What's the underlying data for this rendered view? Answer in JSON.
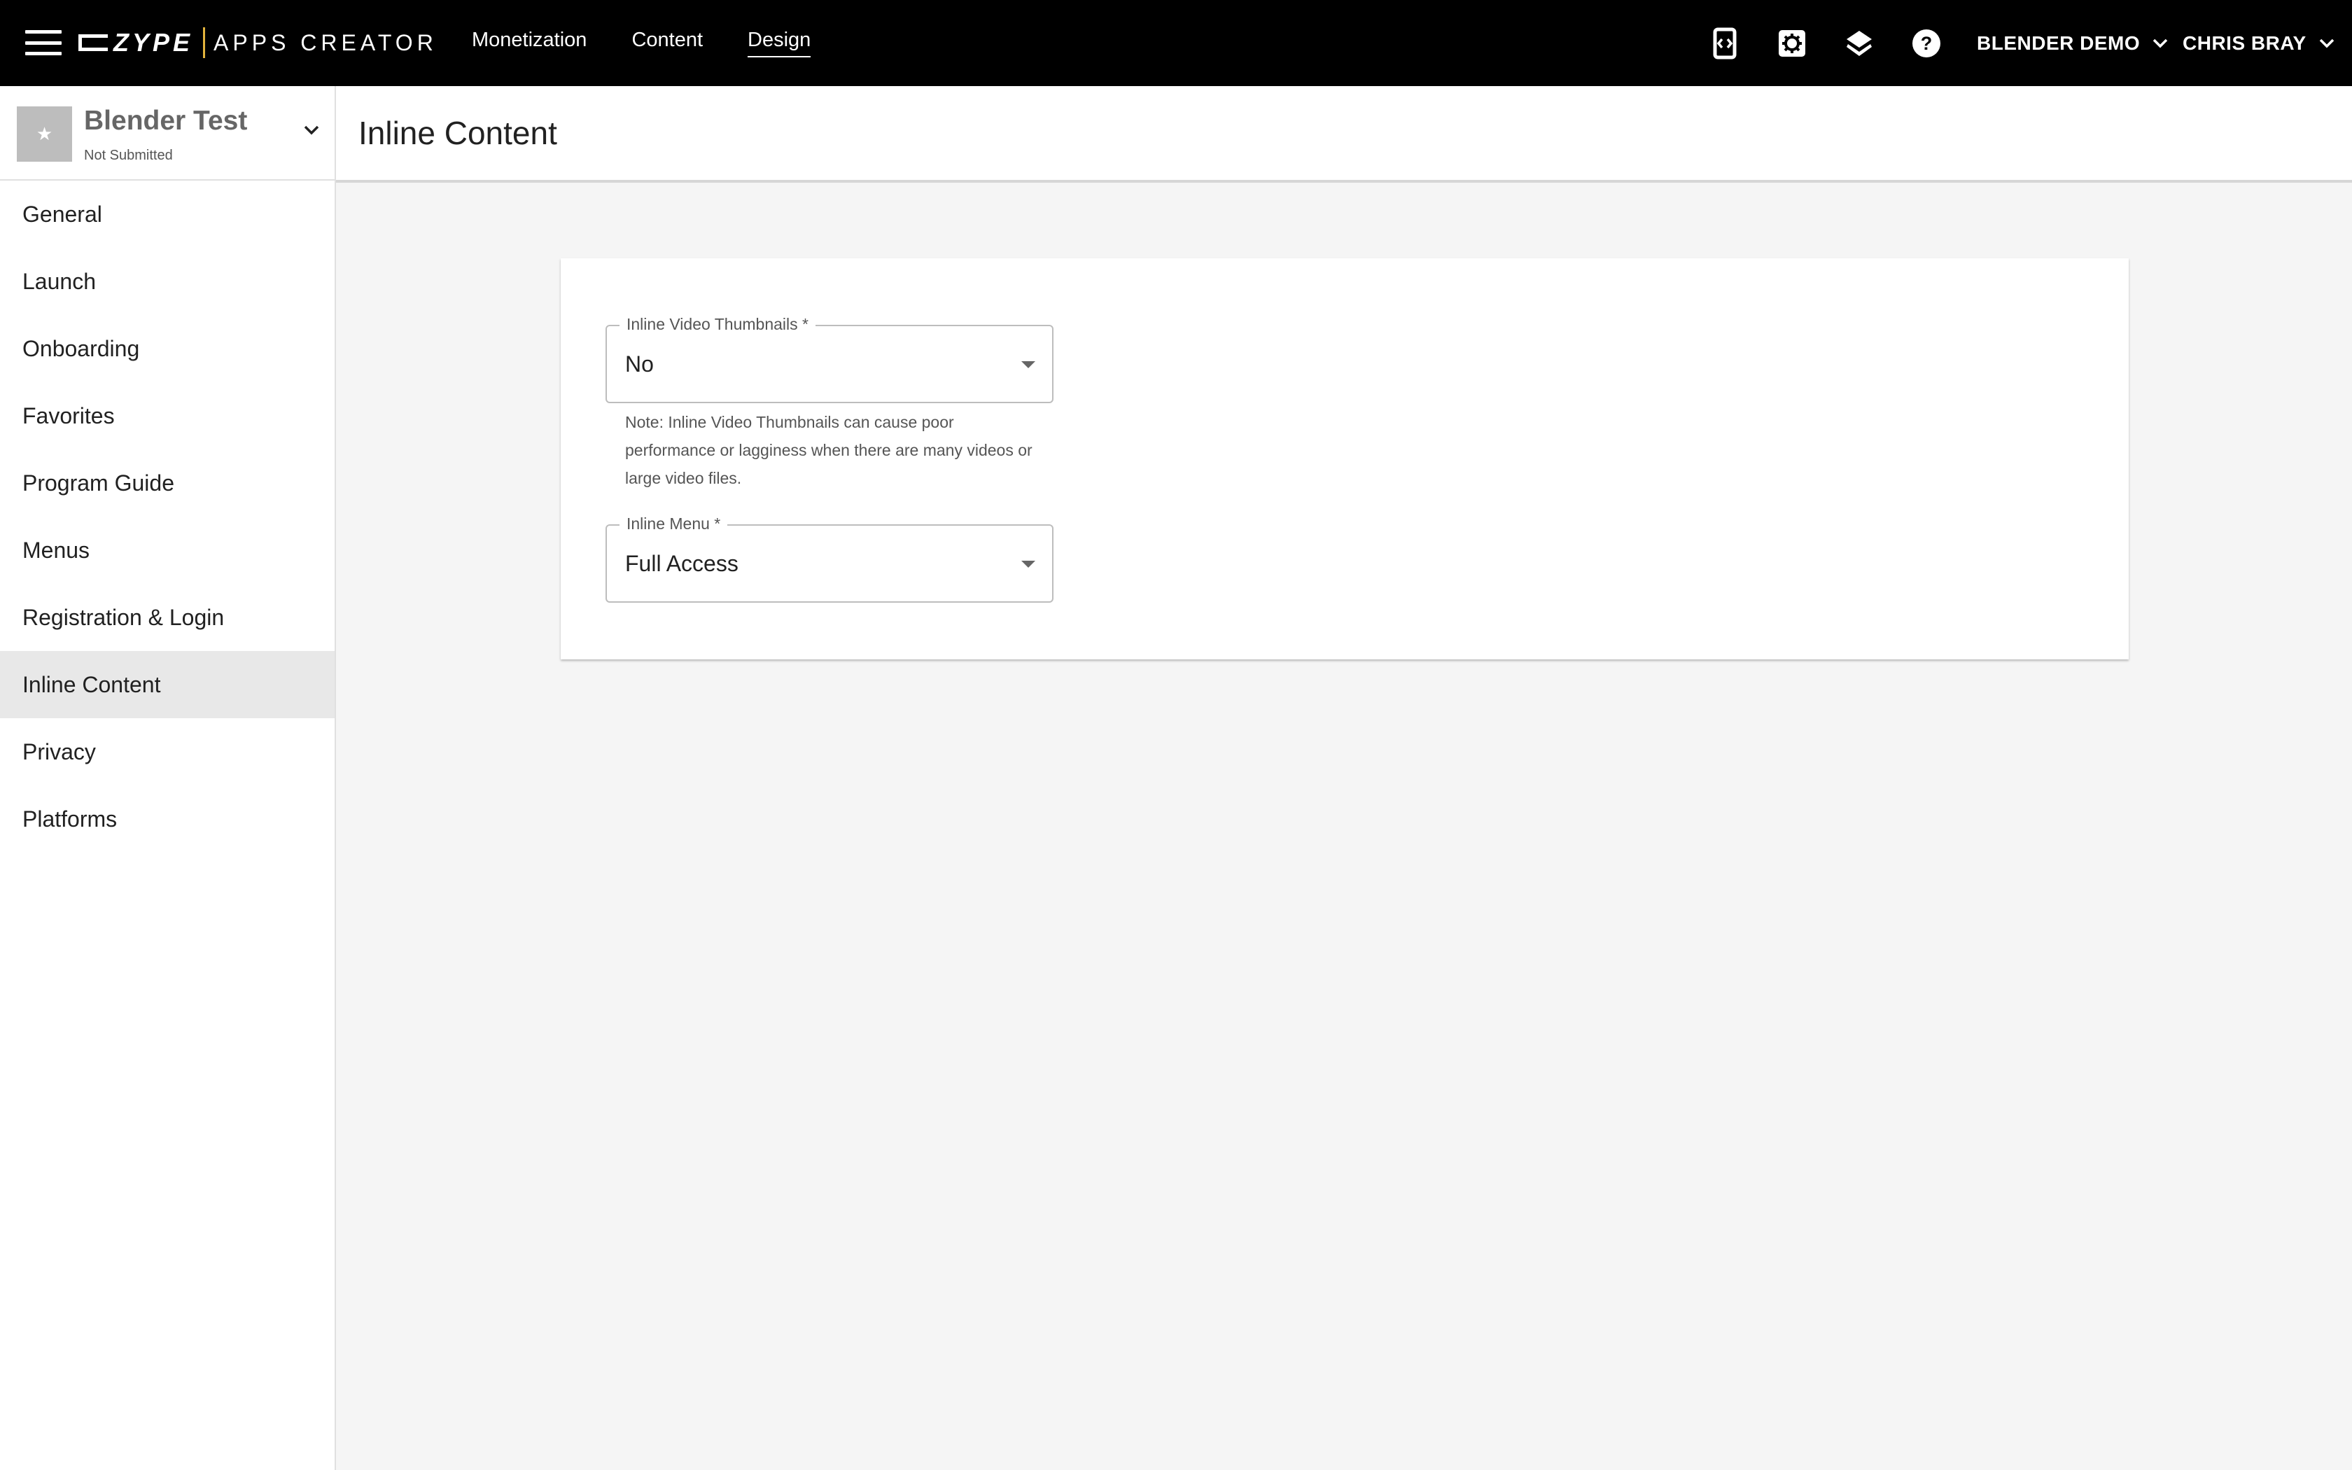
{
  "topbar": {
    "brand": "ZYPE",
    "product": "APPS CREATOR",
    "nav": [
      {
        "label": "Monetization",
        "active": false
      },
      {
        "label": "Content",
        "active": false
      },
      {
        "label": "Design",
        "active": true
      }
    ],
    "icons": [
      "mobile-code-icon",
      "settings-icon",
      "layers-icon",
      "help-icon"
    ],
    "org": "BLENDER DEMO",
    "user": "CHRIS BRAY"
  },
  "sidebar": {
    "app_name": "Blender Test",
    "app_status": "Not Submitted",
    "items": [
      {
        "label": "General"
      },
      {
        "label": "Launch"
      },
      {
        "label": "Onboarding"
      },
      {
        "label": "Favorites"
      },
      {
        "label": "Program Guide"
      },
      {
        "label": "Menus"
      },
      {
        "label": "Registration & Login"
      },
      {
        "label": "Inline Content",
        "active": true
      },
      {
        "label": "Privacy"
      },
      {
        "label": "Platforms"
      }
    ]
  },
  "main": {
    "title": "Inline Content",
    "fields": {
      "thumbnails": {
        "label": "Inline Video Thumbnails *",
        "value": "No",
        "note": "Note: Inline Video Thumbnails can cause poor performance or lagginess when there are many videos or large video files."
      },
      "menu": {
        "label": "Inline Menu *",
        "value": "Full Access"
      }
    }
  }
}
